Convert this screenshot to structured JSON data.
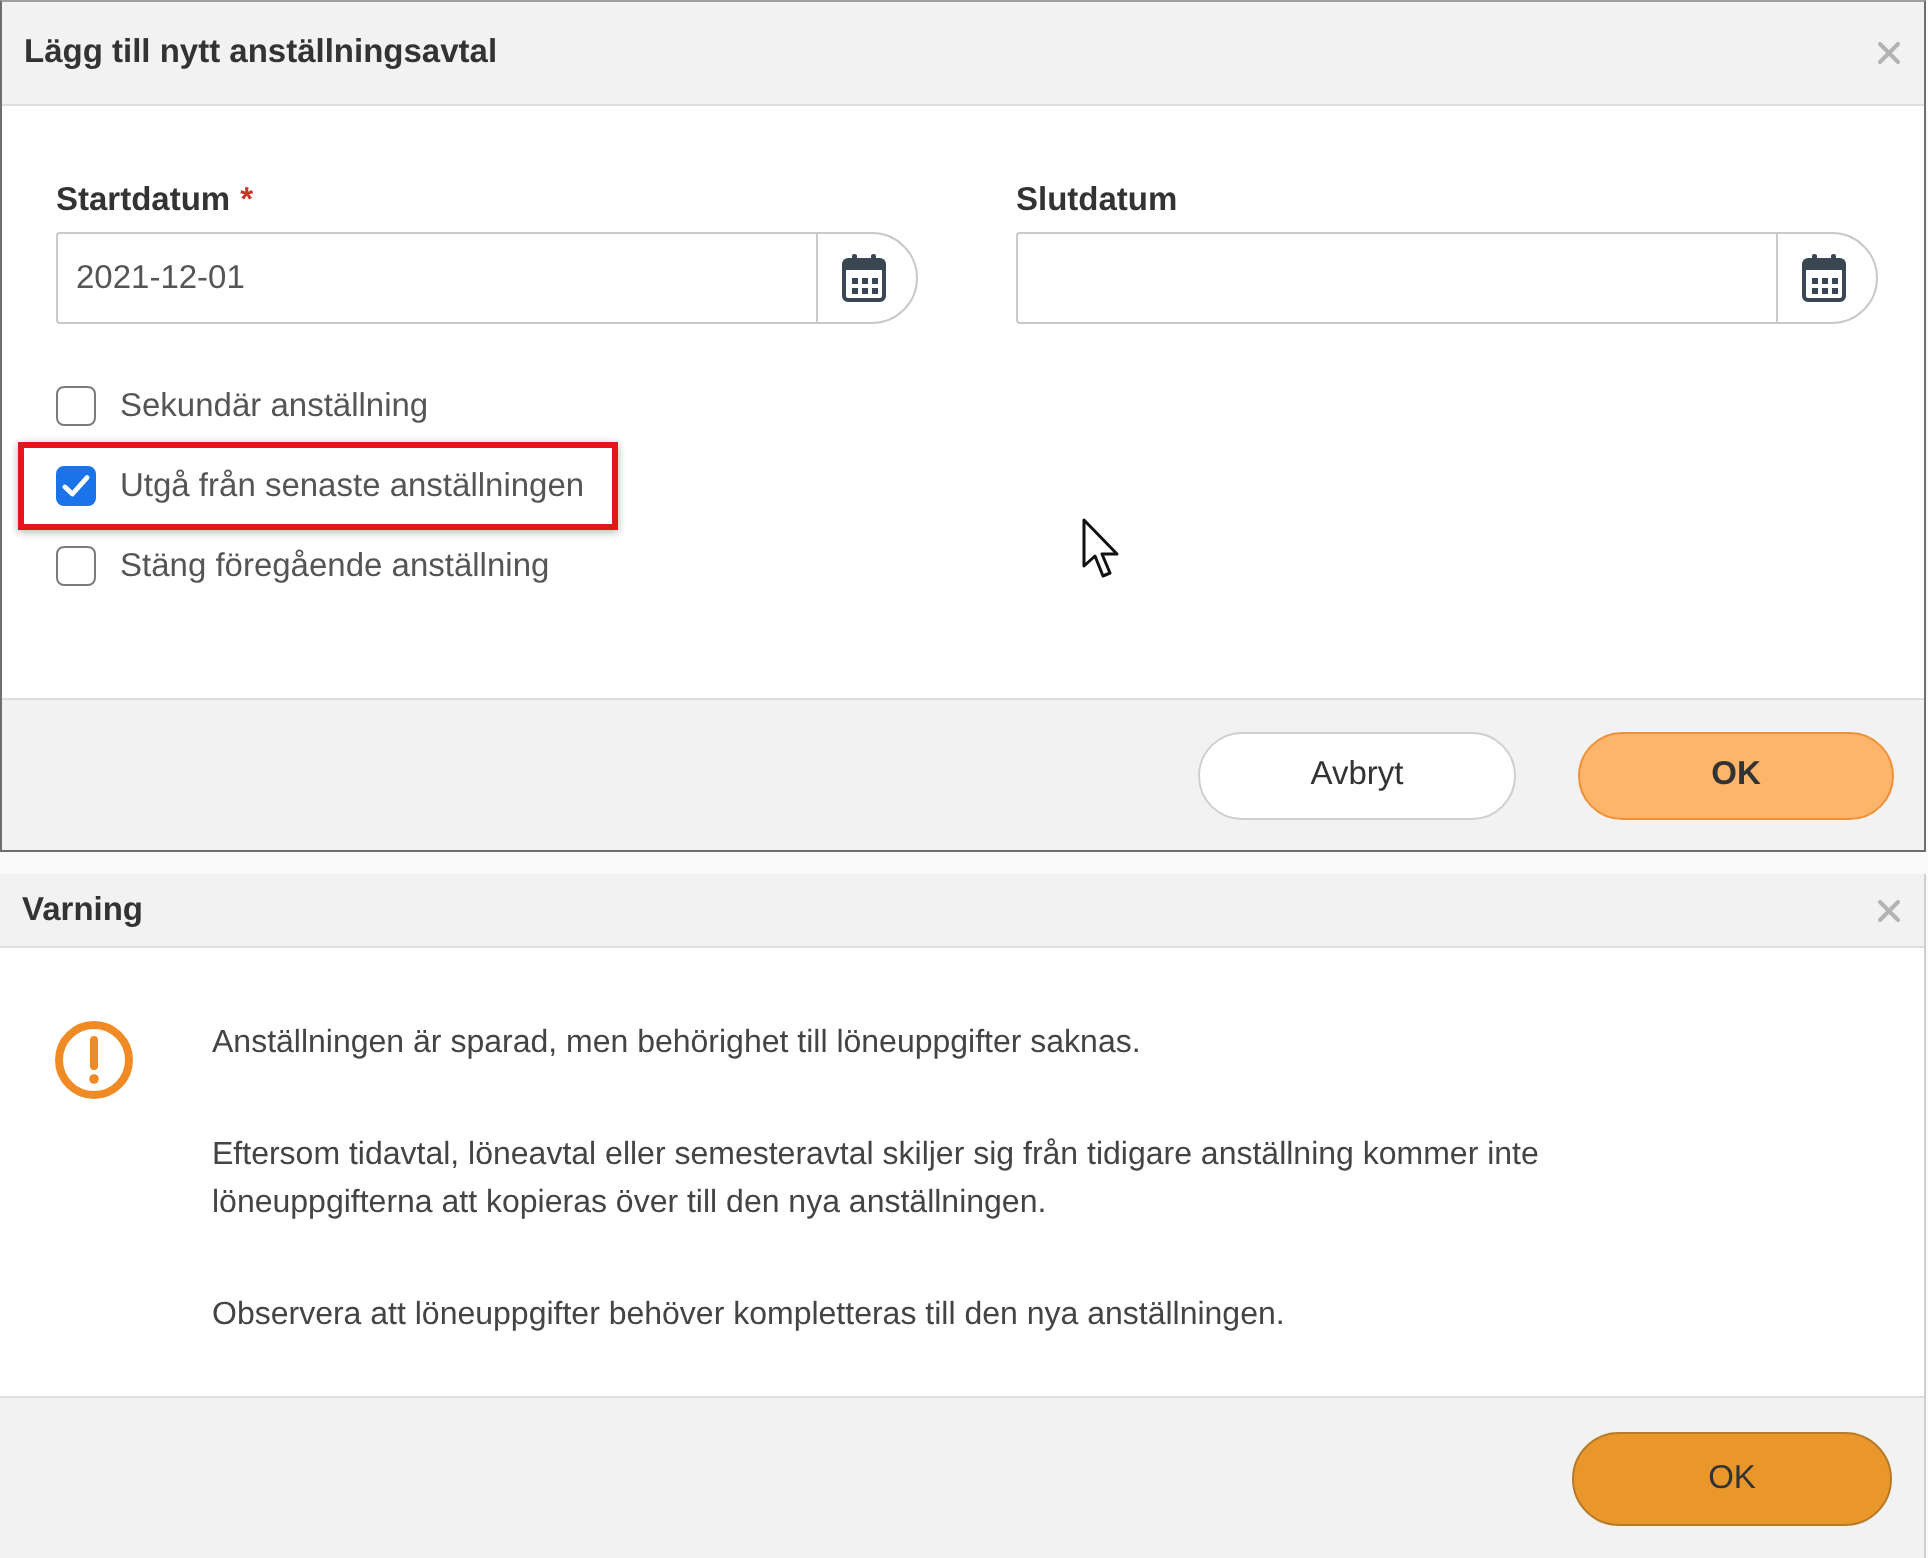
{
  "employment_dialog": {
    "title": "Lägg till nytt anställningsavtal",
    "fields": [
      {
        "label": "Startdatum",
        "required_mark": "*",
        "value": "2021-12-01"
      },
      {
        "label": "Slutdatum"
      }
    ],
    "options": [
      {
        "label": "Sekundär anställning",
        "checked": false,
        "highlighted": false
      },
      {
        "label": "Utgå från senaste anställningen",
        "checked": true,
        "highlighted": true
      },
      {
        "label": "Stäng föregående anställning",
        "checked": false,
        "highlighted": false
      }
    ],
    "buttons": [
      {
        "label": "Avbryt",
        "kind": "outline"
      },
      {
        "label": "OK",
        "kind": "pale"
      }
    ]
  },
  "warning_dialog": {
    "title": "Varning",
    "paragraphs": [
      "Anställningen är sparad, men behörighet till löneuppgifter saknas.",
      "Eftersom tidavtal, löneavtal eller semesteravtal skiljer sig från tidigare anställning kommer inte löneuppgifterna att kopieras över till den nya anställningen.",
      "Observera att löneuppgifter behöver kompletteras till den nya anställningen."
    ],
    "buttons": [
      {
        "label": "OK",
        "kind": "solid"
      }
    ]
  }
}
